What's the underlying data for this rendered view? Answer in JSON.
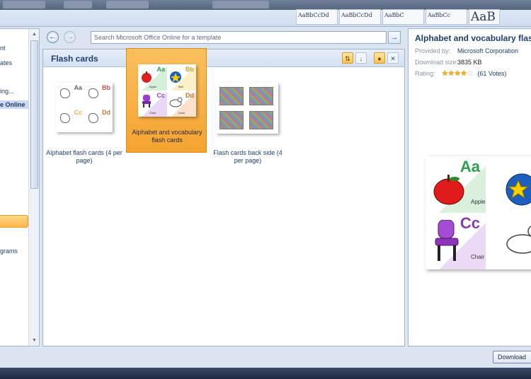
{
  "ribbon": {
    "style_previews": [
      "AaBbCcDd",
      "AaBbCcDd",
      "AaBbC",
      "AaBbCc",
      "AaB"
    ]
  },
  "categories": {
    "items": [
      {
        "label": "nt",
        "selected": false
      },
      {
        "label": "ates",
        "selected": false
      },
      {
        "label": "ing...",
        "selected": false
      },
      {
        "label": "e Online",
        "selected": true
      },
      {
        "label": "",
        "selected": false,
        "highlighted": true
      },
      {
        "label": "grams",
        "selected": false
      }
    ]
  },
  "search": {
    "placeholder": "Search Microsoft Office Online for a template"
  },
  "section": {
    "title": "Flash cards"
  },
  "templates": [
    {
      "caption": "Alphabet flash cards (4 per page)",
      "selected": false
    },
    {
      "caption": "Alphabet and vocabulary flash cards",
      "selected": true
    },
    {
      "caption": "Flash cards back side (4 per page)",
      "selected": false
    }
  ],
  "thumb_cards": [
    {
      "letter": "Aa",
      "label": "Apple",
      "color": "#2aa14c"
    },
    {
      "letter": "Bb",
      "label": "Ball",
      "color": "#d6a21c"
    },
    {
      "letter": "Cc",
      "label": "Chair",
      "color": "#8a3ab9"
    },
    {
      "letter": "Dd",
      "label": "Duck",
      "color": "#d96a1c"
    }
  ],
  "sketch_letters": [
    {
      "letter": "Aa",
      "color": "#666666"
    },
    {
      "letter": "Bb",
      "color": "#d9534f"
    },
    {
      "letter": "Cc",
      "color": "#f0ad4e"
    },
    {
      "letter": "Dd",
      "color": "#c27a3a"
    }
  ],
  "details": {
    "title": "Alphabet and vocabulary flash cards",
    "provided_by_label": "Provided by:",
    "provided_by": "Microsoft Corporation",
    "download_size_label": "Download size:",
    "download_size": "3835 KB",
    "rating_label": "Rating:",
    "rating_stars": 4,
    "rating_max": 5,
    "votes": "(61 Votes)"
  },
  "preview_cards": [
    {
      "letter": "Aa",
      "label": "Apple",
      "color": "#2aa14c"
    },
    {
      "letter": "Cc",
      "label": "Chair",
      "color": "#8a3ab9"
    }
  ],
  "footer": {
    "download_label": "Download"
  },
  "colors": {
    "selection": "#f5a331",
    "heading": "#1e3f6e",
    "star": "#f0b21a"
  }
}
